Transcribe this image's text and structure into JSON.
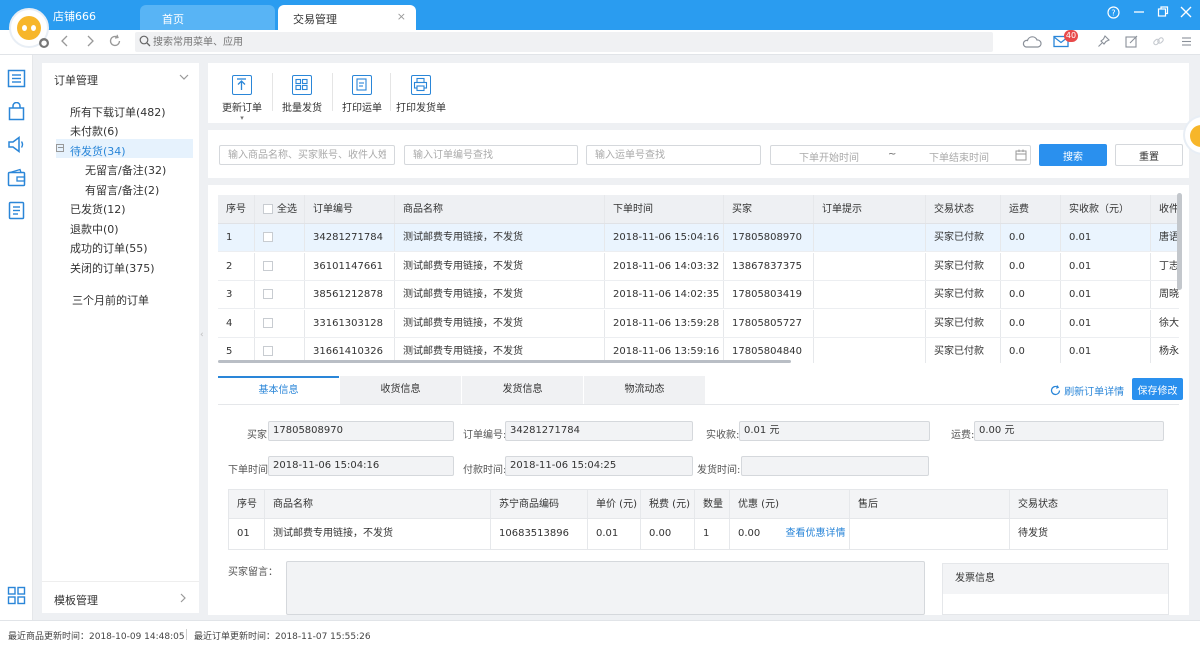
{
  "titlebar": {
    "store_name": "店铺666",
    "tabs": [
      {
        "label": "首页"
      },
      {
        "label": "交易管理"
      }
    ],
    "close_glyph": "×"
  },
  "addressbar": {
    "search_placeholder": "搜索常用菜单、应用",
    "mail_badge": "40"
  },
  "icons": {
    "rail": [
      "order-list-icon",
      "shopping-bag-icon",
      "speaker-icon",
      "wallet-icon",
      "report-icon",
      "apps-grid-icon"
    ],
    "topbar": [
      "cloud-sync-icon",
      "mail-icon",
      "pin-icon",
      "external-link-icon",
      "link-icon",
      "settings-icon"
    ]
  },
  "colors": {
    "accent": "#2a90ee",
    "titlebar": "#2a9cf0",
    "badge": "#e84a4a",
    "selected_row": "#eaf4fe"
  },
  "sidebar": {
    "title": "订单管理",
    "items": [
      {
        "label": "所有下载订单(482)"
      },
      {
        "label": "未付款(6)"
      },
      {
        "label": "待发货(34)"
      },
      {
        "label": "无留言/备注(32)"
      },
      {
        "label": "有留言/备注(2)"
      },
      {
        "label": "已发货(12)"
      },
      {
        "label": "退款中(0)"
      },
      {
        "label": "成功的订单(55)"
      },
      {
        "label": "关闭的订单(375)"
      },
      {
        "label": "三个月前的订单"
      }
    ],
    "expand_glyph": "−",
    "footer": "模板管理"
  },
  "toolbar": {
    "buttons": [
      {
        "label": "更新订单"
      },
      {
        "label": "批量发货"
      },
      {
        "label": "打印运单"
      },
      {
        "label": "打印发货单"
      }
    ]
  },
  "filters": {
    "product_placeholder": "输入商品名称、买家账号、收件人姓...",
    "order_placeholder": "输入订单编号查找",
    "waybill_placeholder": "输入运单号查找",
    "start_time": "下单开始时间",
    "range_sep": "~",
    "end_time": "下单结束时间",
    "search_label": "搜索",
    "reset_label": "重置"
  },
  "orders": {
    "headers": [
      "序号",
      "全选",
      "订单编号",
      "商品名称",
      "下单时间",
      "买家",
      "订单提示",
      "交易状态",
      "运费",
      "实收款（元）",
      "收件"
    ],
    "rows": [
      {
        "no": "1",
        "id": "34281271784",
        "product": "测试邮费专用链接，不发货",
        "time": "2018-11-06 15:04:16",
        "buyer": "17805808970",
        "hint": "",
        "status": "买家已付款",
        "shipping": "0.0",
        "paid": "0.01",
        "recipient": "唐语"
      },
      {
        "no": "2",
        "id": "36101147661",
        "product": "测试邮费专用链接，不发货",
        "time": "2018-11-06 14:03:32",
        "buyer": "13867837375",
        "hint": "",
        "status": "买家已付款",
        "shipping": "0.0",
        "paid": "0.01",
        "recipient": "丁志"
      },
      {
        "no": "3",
        "id": "38561212878",
        "product": "测试邮费专用链接，不发货",
        "time": "2018-11-06 14:02:35",
        "buyer": "17805803419",
        "hint": "",
        "status": "买家已付款",
        "shipping": "0.0",
        "paid": "0.01",
        "recipient": "周晓"
      },
      {
        "no": "4",
        "id": "33161303128",
        "product": "测试邮费专用链接，不发货",
        "time": "2018-11-06 13:59:28",
        "buyer": "17805805727",
        "hint": "",
        "status": "买家已付款",
        "shipping": "0.0",
        "paid": "0.01",
        "recipient": "徐大"
      },
      {
        "no": "5",
        "id": "31661410326",
        "product": "测试邮费专用链接，不发货",
        "time": "2018-11-06 13:59:16",
        "buyer": "17805804840",
        "hint": "",
        "status": "买家已付款",
        "shipping": "0.0",
        "paid": "0.01",
        "recipient": "杨永"
      }
    ]
  },
  "detail": {
    "tabs": [
      "基本信息",
      "收货信息",
      "发货信息",
      "物流动态"
    ],
    "refresh_label": "刷新订单详情",
    "save_label": "保存修改",
    "fields": {
      "buyer_label": "买家:",
      "buyer": "17805808970",
      "order_label": "订单编号:",
      "order_id": "34281271784",
      "paid_label": "实收款:",
      "paid": "0.01 元",
      "shipping_label": "运费:",
      "shipping": "0.00 元",
      "order_time_label": "下单时间:",
      "order_time": "2018-11-06 15:04:16",
      "pay_time_label": "付款时间:",
      "pay_time": "2018-11-06 15:04:25",
      "ship_time_label": "发货时间:",
      "ship_time": ""
    },
    "items_headers": [
      "序号",
      "商品名称",
      "苏宁商品编码",
      "单价 (元)",
      "税费 (元)",
      "数量",
      "优惠 (元)",
      "售后",
      "交易状态"
    ],
    "items": [
      {
        "no": "01",
        "name": "测试邮费专用链接，不发货",
        "code": "10683513896",
        "price": "0.01",
        "tax": "0.00",
        "qty": "1",
        "discount": "0.00",
        "discount_link": "查看优惠详情",
        "after_sale": "",
        "status": "待发货"
      }
    ],
    "memo_label": "买家留言：",
    "invoice_title": "发票信息"
  },
  "statusbar": {
    "product_update": "最近商品更新时间：2018-10-09 14:48:05",
    "order_update": "最近订单更新时间：2018-11-07 15:55:26"
  }
}
